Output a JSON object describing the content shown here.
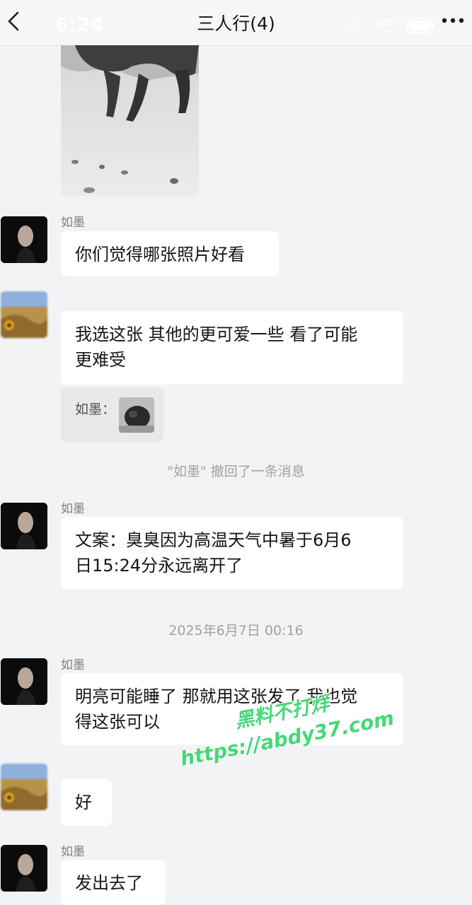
{
  "header": {
    "time": "6:24",
    "title": "三人行(4)",
    "battery": "95"
  },
  "messages": [
    {
      "sender": "如墨",
      "text": "你们觉得哪张照片好看"
    },
    {
      "sender": "",
      "text": "我选这张 其他的更可爱一些 看了可能更难受",
      "line1": "我选这张 其他的更可爱一些 看了可能",
      "line2": "更难受"
    },
    {
      "sender": "如墨",
      "line1": "文案：臭臭因为高温天气中暑于6月6",
      "line2": "日15:24分永远离开了"
    },
    {
      "sender": "如墨",
      "line1": "明亮可能睡了 那就用这张发了 我也觉",
      "line2": "得这张可以"
    },
    {
      "sender": "",
      "text": "好"
    },
    {
      "sender": "如墨",
      "text": "发出去了"
    }
  ],
  "quote": {
    "name": "如墨："
  },
  "system": {
    "recall": "\"如墨\" 撤回了一条消息",
    "timestamp": "2025年6月7日 00:16"
  },
  "watermark": {
    "line1": "黑料不打烊",
    "line2": "https://abdy37.com"
  },
  "colors": {
    "background": "#f3f2f4",
    "bubble": "#ffffff",
    "watermark": "#45d879"
  },
  "icons": [
    "back-icon",
    "more-icon",
    "signal-icon",
    "wifi-icon",
    "battery-icon"
  ]
}
